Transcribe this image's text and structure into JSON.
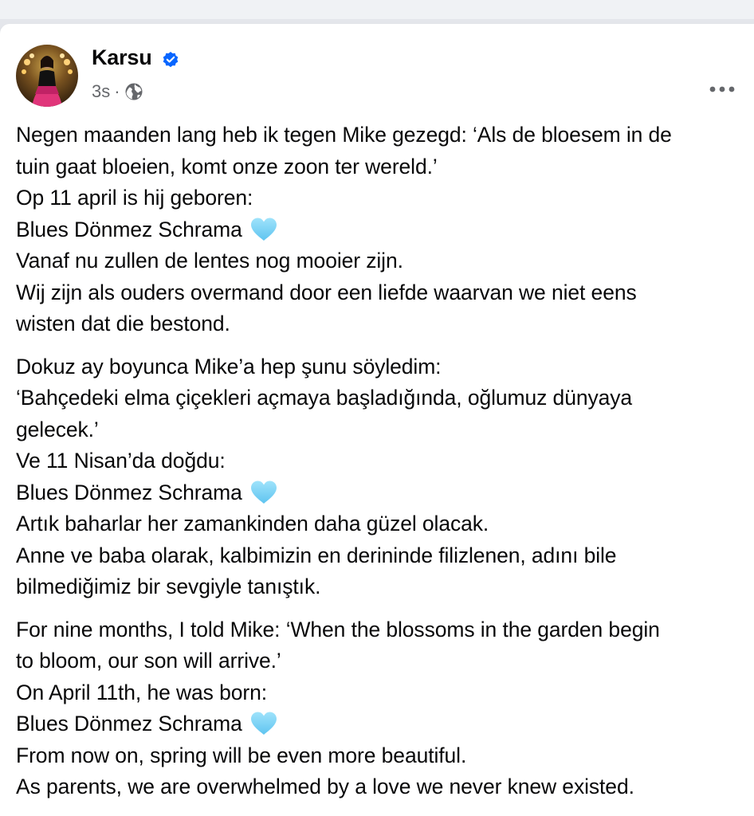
{
  "post": {
    "author": "Karsu",
    "verified_icon": "verified-badge-icon",
    "timestamp": "3s",
    "separator": "·",
    "audience_icon": "globe-icon",
    "more_icon": "more-options-icon",
    "paragraphs": [
      {
        "lines": [
          {
            "text": "Negen maanden lang heb ik tegen Mike gezegd: ‘Als de bloesem in de"
          },
          {
            "text": "tuin gaat bloeien, komt onze zoon ter wereld.’"
          },
          {
            "text": "Op 11 april is hij geboren:"
          },
          {
            "text": "Blues Dönmez Schrama",
            "emoji": "light-blue-heart"
          },
          {
            "text": "Vanaf nu zullen de lentes nog mooier zijn."
          },
          {
            "text": "Wij zijn als ouders overmand door een liefde waarvan we niet eens"
          },
          {
            "text": "wisten dat die bestond."
          }
        ]
      },
      {
        "lines": [
          {
            "text": "Dokuz ay boyunca Mike’a hep şunu söyledim:"
          },
          {
            "text": "‘Bahçedeki elma çiçekleri açmaya başladığında, oğlumuz dünyaya"
          },
          {
            "text": "gelecek.’"
          },
          {
            "text": "Ve 11 Nisan’da doğdu:"
          },
          {
            "text": "Blues Dönmez Schrama",
            "emoji": "light-blue-heart"
          },
          {
            "text": "Artık baharlar her zamankinden daha güzel olacak."
          },
          {
            "text": "Anne ve baba olarak, kalbimizin en derininde filizlenen, adını bile"
          },
          {
            "text": "bilmediğimiz bir sevgiyle tanıştık."
          }
        ]
      },
      {
        "lines": [
          {
            "text": "For nine months, I told Mike: ‘When the blossoms in the garden begin"
          },
          {
            "text": "to bloom, our son will arrive.’"
          },
          {
            "text": "On April 11th, he was born:"
          },
          {
            "text": "Blues Dönmez Schrama",
            "emoji": "light-blue-heart"
          },
          {
            "text": "From now on, spring will be even more beautiful."
          },
          {
            "text": "As parents, we are overwhelmed by a love we never knew existed."
          }
        ]
      }
    ]
  },
  "colors": {
    "text": "#080809",
    "secondary_text": "#65676b",
    "verified_blue": "#0866ff",
    "heart_blue": "#7dd3f7"
  }
}
